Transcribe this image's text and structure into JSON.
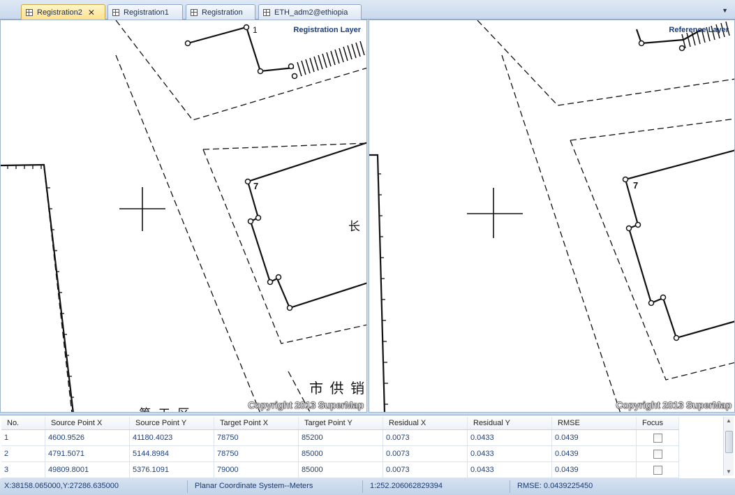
{
  "tabs": [
    {
      "label": "Registration2",
      "active": true,
      "closable": true
    },
    {
      "label": "Registration1",
      "active": false
    },
    {
      "label": "Registration",
      "active": false
    },
    {
      "label": "ETH_adm2@ethiopia",
      "active": false
    }
  ],
  "left_map": {
    "layer_label": "Registration Layer",
    "copyright": "Copyright 2013 SuperMap",
    "parcel_number": "7",
    "parcel_number_top": "1",
    "text_chang": "长 ",
    "text_shigongxiao": "市 供 销",
    "text_bottom": "第 工 区"
  },
  "right_map": {
    "layer_label": "Reference Layer",
    "copyright": "Copyright 2013 SuperMap",
    "parcel_number": "7"
  },
  "table": {
    "columns": [
      "No.",
      "Source Point X",
      "Source Point Y",
      "Target Point X",
      "Target Point Y",
      "Residual X",
      "Residual Y",
      "RMSE",
      "Focus"
    ],
    "rows": [
      {
        "no": "1",
        "sx": "4600.9526",
        "sy": "41180.4023",
        "tx": "78750",
        "ty": "85200",
        "rx": "0.0073",
        "ry": "0.0433",
        "rmse": "0.0439",
        "focus": false
      },
      {
        "no": "2",
        "sx": "4791.5071",
        "sy": "5144.8984",
        "tx": "78750",
        "ty": "85000",
        "rx": "0.0073",
        "ry": "0.0433",
        "rmse": "0.0439",
        "focus": false
      },
      {
        "no": "3",
        "sx": "49809.8001",
        "sy": "5376.1091",
        "tx": "79000",
        "ty": "85000",
        "rx": "0.0073",
        "ry": "0.0433",
        "rmse": "0.0439",
        "focus": false
      }
    ]
  },
  "status": {
    "coordinates": "X:38158.065000,Y:27286.635000",
    "coord_system": "Planar Coordinate System--Meters",
    "scale": "1:252.206062829394",
    "rmse": "RMSE: 0.0439225450"
  },
  "colors": {
    "accent": "#1a3d7c",
    "active_tab": "#fde08a"
  }
}
